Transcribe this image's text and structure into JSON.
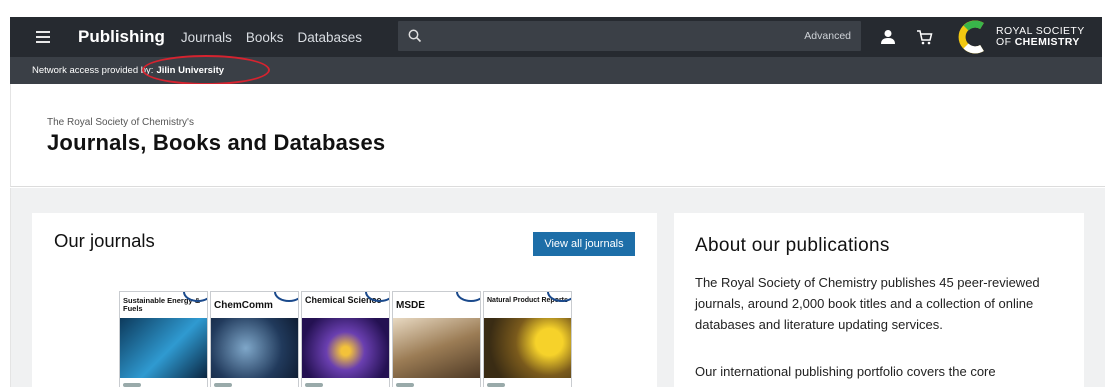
{
  "topbar": {
    "brand": "Publishing",
    "nav": [
      "Journals",
      "Books",
      "Databases"
    ],
    "search_placeholder": "",
    "advanced_label": "Advanced",
    "logo_line1": "ROYAL SOCIETY",
    "logo_line2_prefix": "OF ",
    "logo_line2_bold": "CHEMISTRY"
  },
  "access": {
    "text": "Network access provided by:",
    "institution": "Jilin University"
  },
  "hero": {
    "subtitle": "The Royal Society of Chemistry's",
    "title": "Journals, Books and Databases"
  },
  "journals": {
    "heading": "Our journals",
    "view_all_label": "View all journals",
    "covers": [
      {
        "title": "Sustainable Energy & Fuels",
        "art_color": "#1f6fa8"
      },
      {
        "title": "ChemComm",
        "art_color": "#2a4f7c"
      },
      {
        "title": "Chemical Science",
        "art_color": "#6a3fb0"
      },
      {
        "title": "MSDE",
        "art_color": "#8a6b4a"
      },
      {
        "title": "Natural Product Reports",
        "art_color": "#c79a1a"
      }
    ]
  },
  "about": {
    "heading": "About our publications",
    "p1": "The Royal Society of Chemistry publishes 45 peer-reviewed journals, around 2,000 book titles and a collection of online databases and literature updating services.",
    "p2": "Our international publishing portfolio covers the core"
  },
  "colors": {
    "topbar": "#262a30",
    "accessbar": "#3a3f46",
    "button": "#1d6ea8",
    "highlight": "#d6232f"
  }
}
